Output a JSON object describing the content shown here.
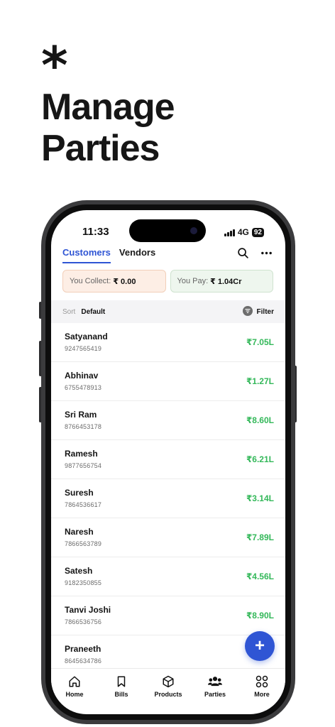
{
  "hero": {
    "symbol": "*",
    "title": "Manage Parties"
  },
  "status_bar": {
    "time": "11:33",
    "network": "4G",
    "battery": "92"
  },
  "tabs": [
    {
      "label": "Customers",
      "active": true
    },
    {
      "label": "Vendors",
      "active": false
    }
  ],
  "icons": {
    "search": "search-icon",
    "more": "more-horizontal-icon"
  },
  "summary": {
    "collect_label": "You Collect:",
    "collect_amount": "₹ 0.00",
    "pay_label": "You Pay:",
    "pay_amount": "₹ 1.04Cr"
  },
  "sort": {
    "label": "Sort",
    "value": "Default",
    "filter_label": "Filter"
  },
  "parties": [
    {
      "name": "Satyanand",
      "phone": "9247565419",
      "amount": "₹7.05L"
    },
    {
      "name": "Abhinav",
      "phone": "6755478913",
      "amount": "₹1.27L"
    },
    {
      "name": "Sri Ram",
      "phone": "8766453178",
      "amount": "₹8.60L"
    },
    {
      "name": "Ramesh",
      "phone": "9877656754",
      "amount": "₹6.21L"
    },
    {
      "name": "Suresh",
      "phone": "7864536617",
      "amount": "₹3.14L"
    },
    {
      "name": "Naresh",
      "phone": "7866563789",
      "amount": "₹7.89L"
    },
    {
      "name": "Satesh",
      "phone": "9182350855",
      "amount": "₹4.56L"
    },
    {
      "name": "Tanvi Joshi",
      "phone": "7866536756",
      "amount": "₹8.90L"
    },
    {
      "name": "Praneeth",
      "phone": "8645634786",
      "amount": ""
    }
  ],
  "fab": {
    "symbol": "+"
  },
  "nav": [
    {
      "label": "Home",
      "icon": "home-icon"
    },
    {
      "label": "Bills",
      "icon": "bookmark-icon"
    },
    {
      "label": "Products",
      "icon": "box-icon"
    },
    {
      "label": "Parties",
      "icon": "users-icon"
    },
    {
      "label": "More",
      "icon": "grid-icon"
    }
  ],
  "colors": {
    "accent": "#2f55d4",
    "positive": "#34b85a",
    "collect_bg": "#fdeee5",
    "pay_bg": "#eef6ee"
  }
}
